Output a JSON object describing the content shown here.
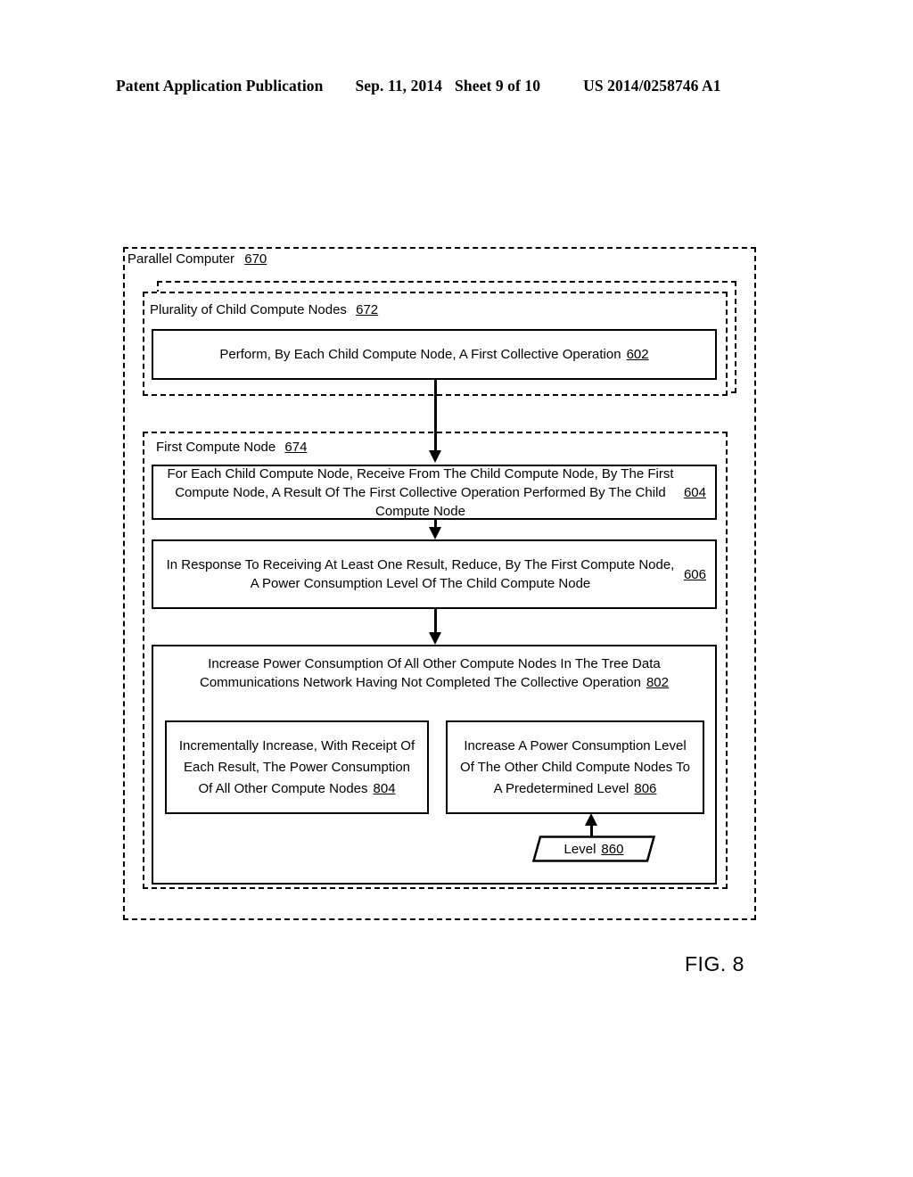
{
  "header": {
    "publication": "Patent Application Publication",
    "date": "Sep. 11, 2014",
    "sheet": "Sheet 9 of 10",
    "patent_number": "US 2014/0258746 A1"
  },
  "figure": {
    "label": "FIG. 8"
  },
  "diagram": {
    "type": "flowchart",
    "containers": [
      {
        "id": "670",
        "name": "parallel-computer",
        "label": "Parallel Computer",
        "ref": "670",
        "style": "dashed"
      },
      {
        "id": "672",
        "name": "plurality-of-child-compute-nodes",
        "label": "Plurality of Child Compute Nodes",
        "ref": "672",
        "style": "dashed-stacked"
      },
      {
        "id": "674",
        "name": "first-compute-node",
        "label": "First Compute Node",
        "ref": "674",
        "style": "dashed"
      }
    ],
    "steps": [
      {
        "id": "602",
        "name": "perform-first-collective-operation",
        "text": "Perform, By Each Child Compute Node, A First Collective Operation",
        "ref": "602"
      },
      {
        "id": "604",
        "name": "receive-result-from-child-compute-node",
        "text": "For Each Child Compute Node, Receive From The Child Compute Node, By The First Compute Node, A Result Of The First Collective Operation Performed By The Child Compute Node",
        "ref": "604"
      },
      {
        "id": "606",
        "name": "reduce-power-consumption-level",
        "text": "In Response To Receiving At Least One Result, Reduce, By The First Compute Node, A Power Consumption Level Of The Child Compute Node",
        "ref": "606"
      },
      {
        "id": "802",
        "name": "increase-power-consumption-other-nodes",
        "text": "Increase Power Consumption Of All Other Compute Nodes In The Tree Data Communications Network Having Not Completed The Collective Operation",
        "ref": "802"
      },
      {
        "id": "804",
        "name": "incrementally-increase-power-consumption",
        "text": "Incrementally Increase, With Receipt Of Each Result, The Power Consumption Of All Other Compute Nodes",
        "ref": "804"
      },
      {
        "id": "806",
        "name": "increase-to-predetermined-level",
        "text": "Increase A Power Consumption Level Of The Other Child Compute Nodes To A Predetermined Level",
        "ref": "806"
      }
    ],
    "data_items": [
      {
        "id": "860",
        "name": "level-data",
        "text": "Level",
        "ref": "860",
        "shape": "parallelogram"
      }
    ],
    "connectors": [
      {
        "from": "602",
        "to": "604",
        "direction": "down"
      },
      {
        "from": "604",
        "to": "606",
        "direction": "down"
      },
      {
        "from": "606",
        "to": "802",
        "direction": "down"
      },
      {
        "from": "860",
        "to": "806",
        "direction": "up"
      }
    ]
  },
  "colors": {
    "ink": "#000000",
    "paper": "#ffffff"
  }
}
